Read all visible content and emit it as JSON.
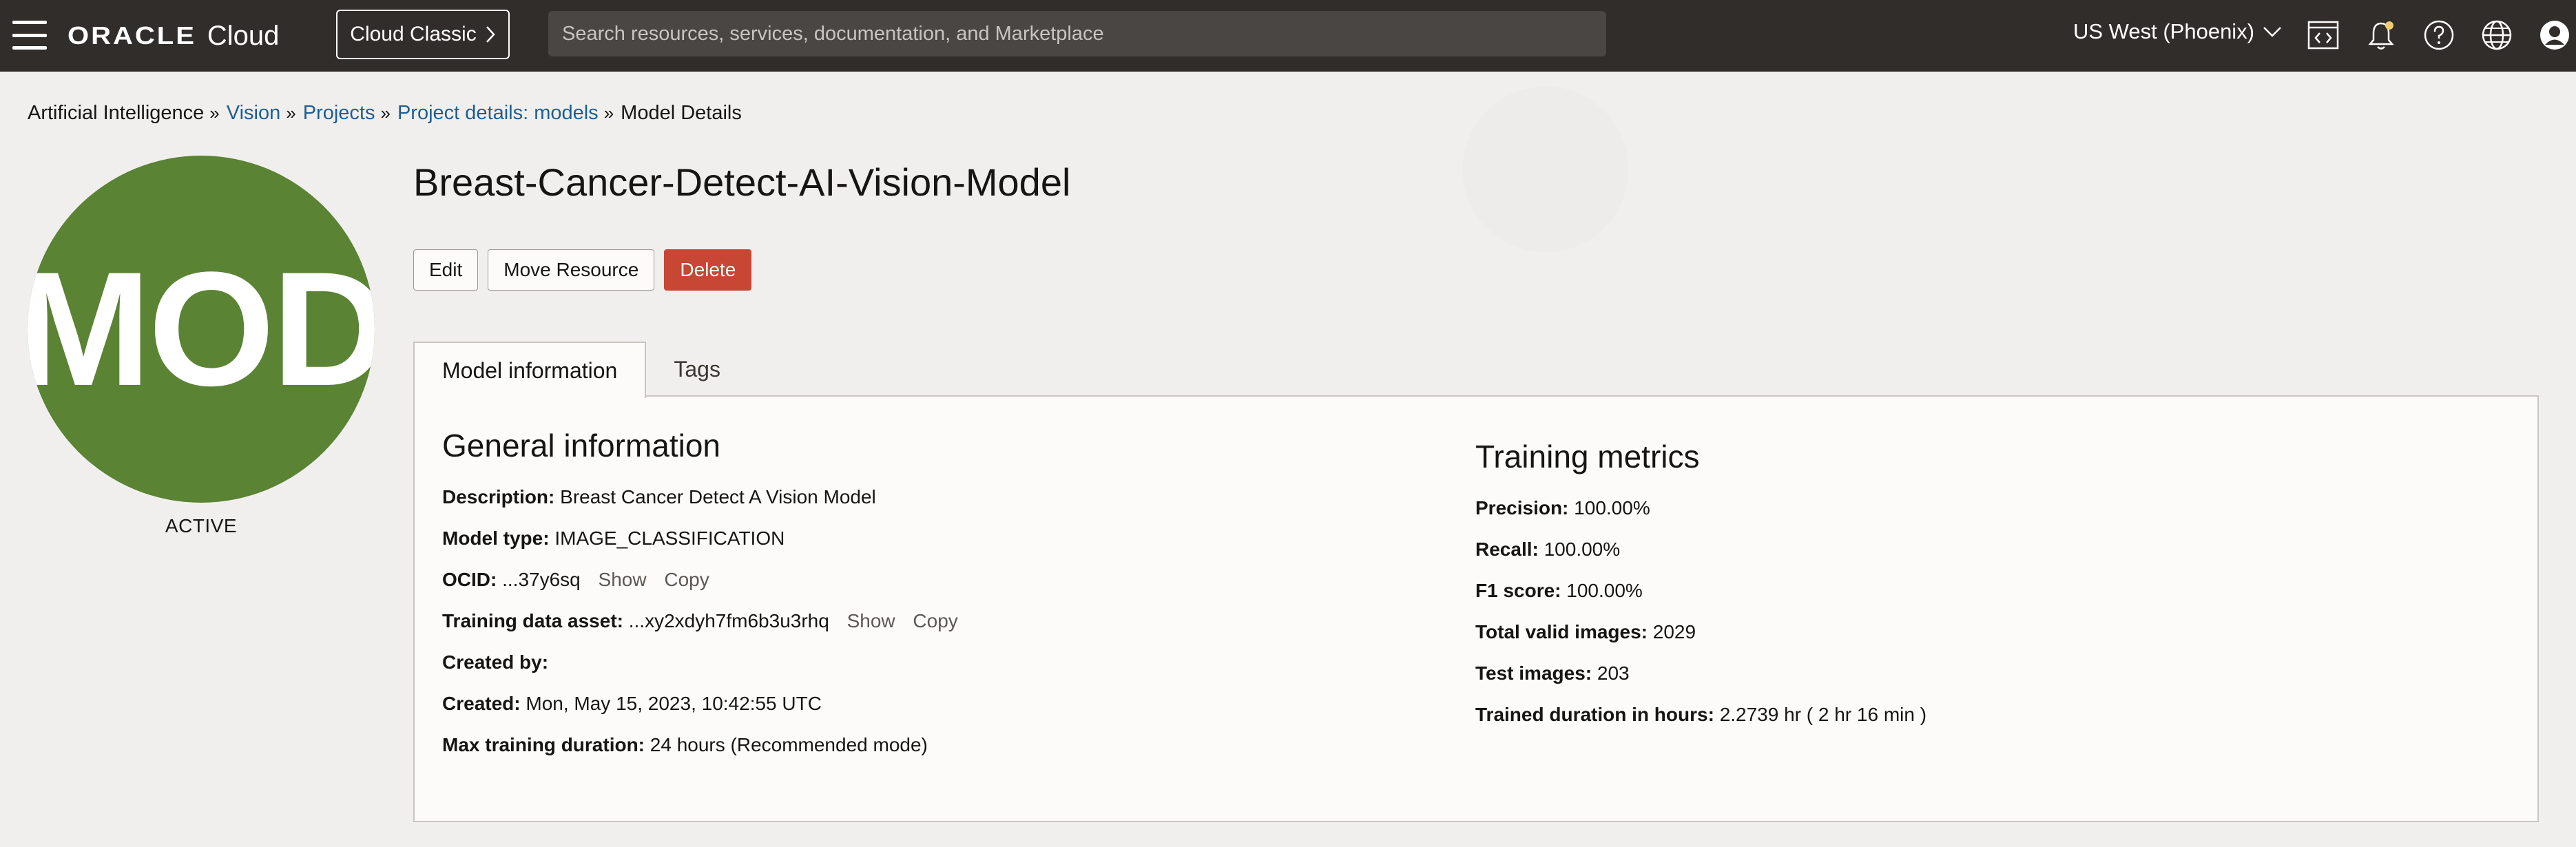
{
  "header": {
    "brand_oracle": "ORACLE",
    "brand_cloud": "Cloud",
    "classic_label": "Cloud Classic",
    "search_placeholder": "Search resources, services, documentation, and Marketplace",
    "region": "US West (Phoenix)"
  },
  "breadcrumb": [
    {
      "label": "Artificial Intelligence",
      "link": false
    },
    {
      "label": "Vision",
      "link": true
    },
    {
      "label": "Projects",
      "link": true
    },
    {
      "label": "Project details: models",
      "link": true
    },
    {
      "label": "Model Details",
      "link": false
    }
  ],
  "avatar": {
    "initials": "MOD",
    "status": "ACTIVE",
    "color": "#5a8334"
  },
  "title": "Breast-Cancer-Detect-AI-Vision-Model",
  "actions": {
    "edit": "Edit",
    "move": "Move Resource",
    "delete": "Delete"
  },
  "tabs": [
    "Model information",
    "Tags"
  ],
  "general": {
    "title": "General information",
    "description": {
      "label": "Description:",
      "value": "Breast Cancer Detect A Vision Model"
    },
    "model_type": {
      "label": "Model type:",
      "value": "IMAGE_CLASSIFICATION"
    },
    "ocid": {
      "label": "OCID:",
      "value": "...37y6sq",
      "show": "Show",
      "copy": "Copy"
    },
    "training_asset": {
      "label": "Training data asset:",
      "value": "...xy2xdyh7fm6b3u3rhq",
      "show": "Show",
      "copy": "Copy"
    },
    "created_by": {
      "label": "Created by:",
      "value": ""
    },
    "created": {
      "label": "Created:",
      "value": "Mon, May 15, 2023, 10:42:55 UTC"
    },
    "max_duration": {
      "label": "Max training duration:",
      "value": "24 hours (Recommended mode)"
    }
  },
  "metrics": {
    "title": "Training metrics",
    "precision": {
      "label": "Precision:",
      "value": "100.00%"
    },
    "recall": {
      "label": "Recall:",
      "value": "100.00%"
    },
    "f1": {
      "label": "F1 score:",
      "value": "100.00%"
    },
    "total_images": {
      "label": "Total valid images:",
      "value": "2029"
    },
    "test_images": {
      "label": "Test images:",
      "value": "203"
    },
    "duration": {
      "label": "Trained duration in hours:",
      "value": "2.2739 hr ( 2 hr 16 min )"
    }
  },
  "colors": {
    "topbar": "#312d2a",
    "link": "#1e5d93",
    "danger": "#c74634"
  }
}
